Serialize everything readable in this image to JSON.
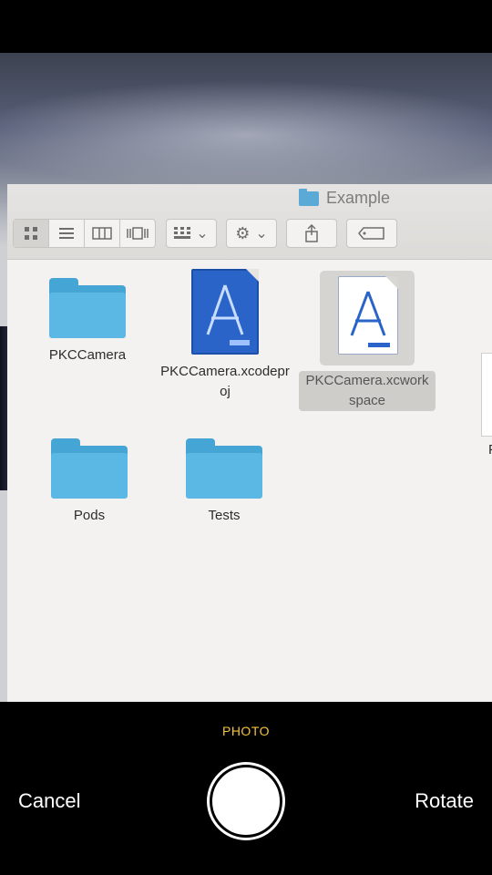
{
  "finder": {
    "window_title": "Example",
    "items": [
      {
        "label": "PKCCamera",
        "type": "folder"
      },
      {
        "label": "PKCCamera.xcodeproj",
        "type": "xcodeproj"
      },
      {
        "label": "PKCCamera.xcworkspace",
        "type": "xcworkspace",
        "selected": true
      },
      {
        "label": "Pods",
        "type": "folder"
      },
      {
        "label": "Tests",
        "type": "folder"
      },
      {
        "label": "P",
        "type": "partial"
      }
    ],
    "toolbar_icons": [
      "icon-view-icon",
      "list-view-icon",
      "column-view-icon",
      "coverflow-view-icon",
      "arrange-icon",
      "gear-icon",
      "share-icon",
      "tag-icon"
    ]
  },
  "camera": {
    "mode": "PHOTO",
    "cancel_label": "Cancel",
    "rotate_label": "Rotate",
    "accent_color": "#f5c33b"
  }
}
